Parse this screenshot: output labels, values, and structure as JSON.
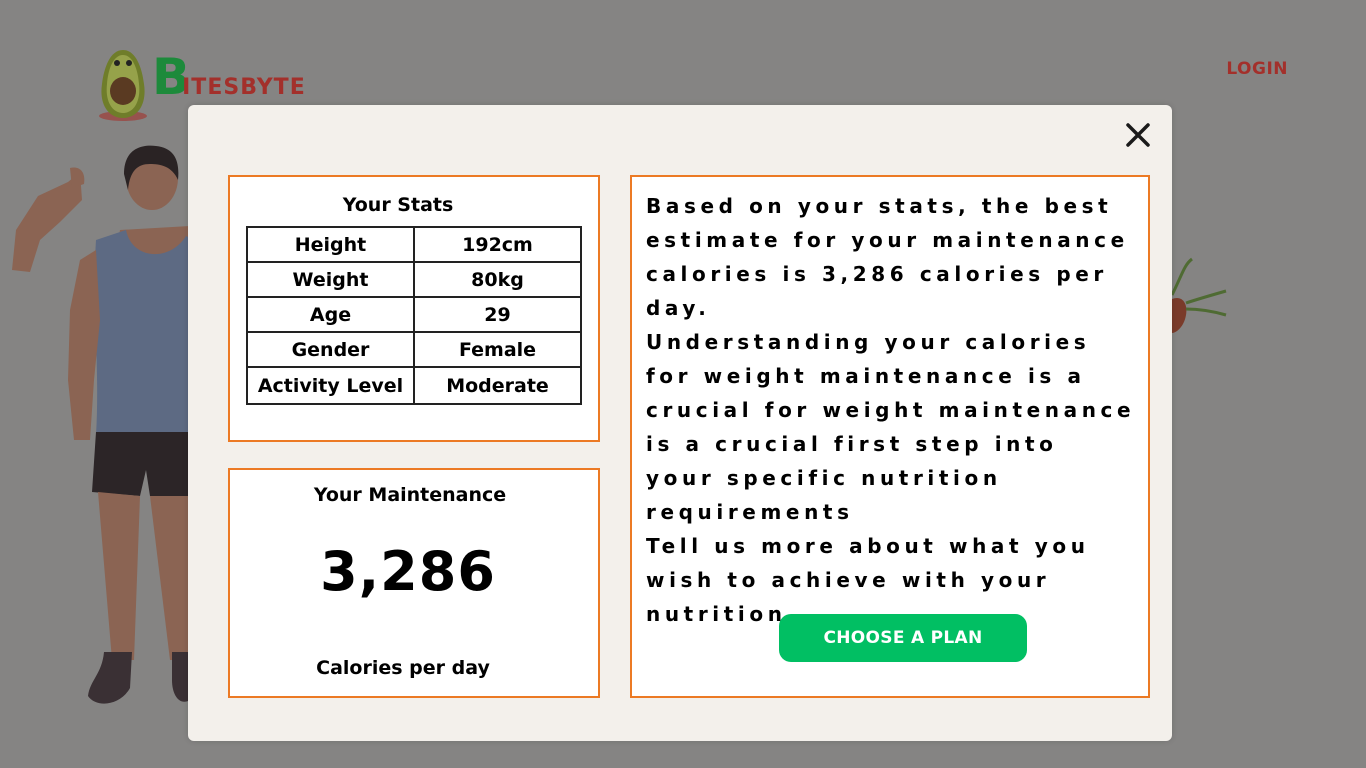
{
  "header": {
    "brand_initial": "B",
    "brand_rest": "ITESBYTE",
    "login_label": "LOGIN"
  },
  "modal": {
    "stats": {
      "title": "Your Stats",
      "rows": [
        {
          "label": "Height",
          "value": "192cm"
        },
        {
          "label": "Weight",
          "value": "80kg"
        },
        {
          "label": "Age",
          "value": "29"
        },
        {
          "label": "Gender",
          "value": "Female"
        },
        {
          "label": "Activity Level",
          "value": "Moderate"
        }
      ]
    },
    "maintenance": {
      "title": "Your Maintenance",
      "value": "3,286",
      "unit": "Calories per day"
    },
    "info": {
      "paragraph_1": "Based on your stats, the best estimate for your maintenance calories is 3,286 calories per day.",
      "paragraph_2": "Understanding your calories for weight maintenance is a crucial for weight maintenance is a crucial first step into your specific nutrition requirements",
      "paragraph_3": "Tell us more about what you wish to achieve with your nutrition",
      "button_label": "CHOOSE A PLAN"
    }
  },
  "colors": {
    "overlay": "#858483",
    "modal_bg": "#f3f0eb",
    "panel_border": "#ec7a24",
    "button": "#01bf63",
    "brand_green": "#1d8a3b",
    "brand_red": "#a3302b"
  }
}
